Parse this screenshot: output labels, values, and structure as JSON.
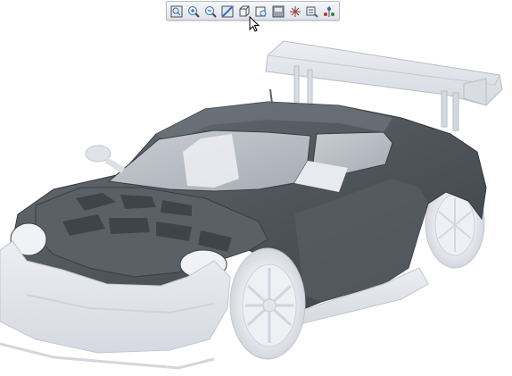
{
  "toolbar": {
    "buttons": [
      {
        "icon": "zoom-fit-icon"
      },
      {
        "icon": "zoom-in-icon"
      },
      {
        "icon": "zoom-out-icon"
      },
      {
        "icon": "repaint-icon"
      },
      {
        "icon": "view-orientation-icon"
      },
      {
        "icon": "saved-views-icon"
      },
      {
        "icon": "display-style-icon"
      },
      {
        "icon": "datum-display-icon"
      },
      {
        "icon": "annotation-display-icon"
      },
      {
        "icon": "spin-center-icon"
      }
    ]
  },
  "colors": {
    "body_dark": "#4d5359",
    "body_light": "#e2e4ea",
    "toolbar_bg": "#e9ecf0",
    "background": "#ffffff"
  }
}
